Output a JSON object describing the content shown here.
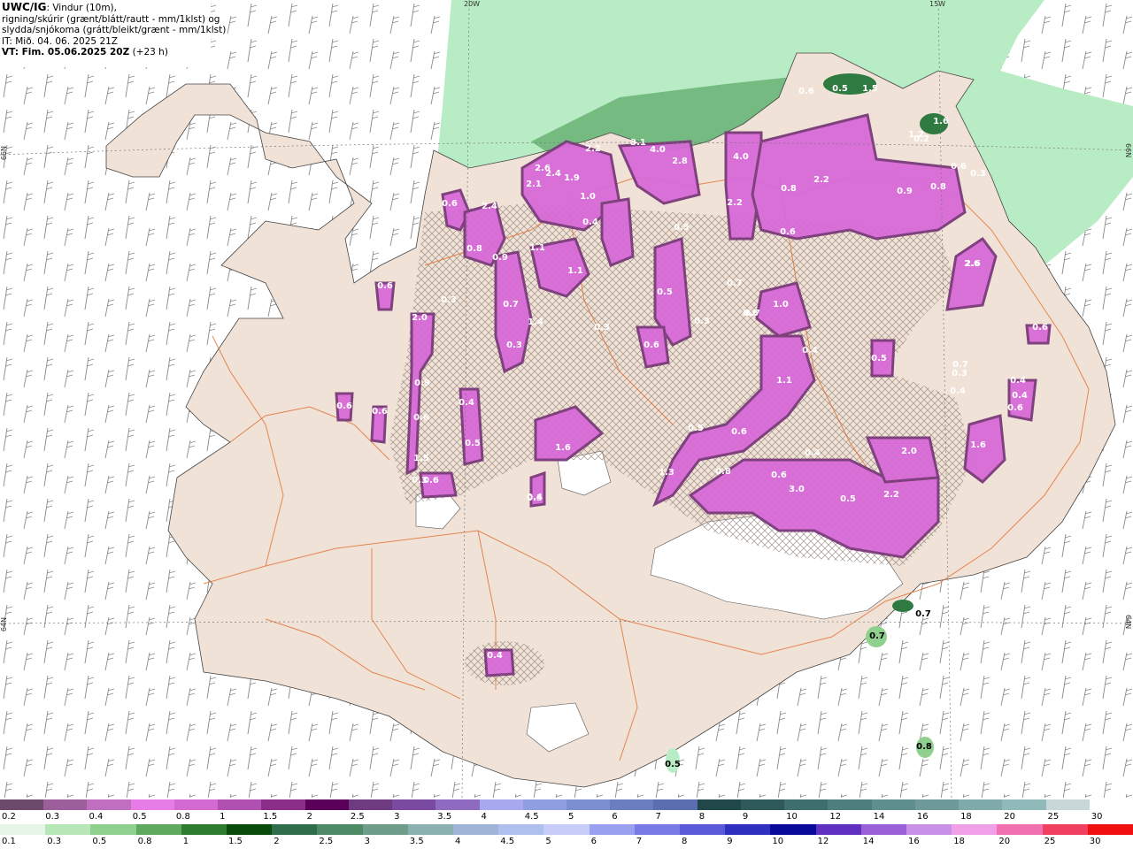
{
  "header": {
    "source": "UWC/IG",
    "title_rest": ": Vindur (10m),",
    "line2": "rigning/skúrir (grænt/blátt/rautt - mm/1klst) og",
    "line3": "slydda/snjókoma (grátt/bleikt/grænt - mm/1klst)",
    "it": "IT: Mið. 04. 06. 2025 21Z",
    "vt_bold": "VT: Fim. 05.06.2025 20Z",
    "vt_rest": " (+23 h)"
  },
  "axes": {
    "top_left": "20W",
    "top_right": "15W",
    "left_upper": "66N",
    "left_lower": "64N",
    "right_upper": "66N",
    "right_lower": "64N"
  },
  "labels": [
    "0.6",
    "0.5",
    "1.5",
    "1.6",
    "1.2",
    "0.2",
    "0.6",
    "0.3",
    "2.6",
    "2.2",
    "3.1",
    "4.0",
    "2.8",
    "4.0",
    "2.2",
    "0.8",
    "0.9",
    "0.8",
    "2.1",
    "2.6",
    "2.4",
    "1.9",
    "1.0",
    "2.2",
    "0.6",
    "2.4",
    "0.9",
    "0.8",
    "1.1",
    "1.1",
    "0.4",
    "0.5",
    "0.6",
    "0.7",
    "0.3",
    "0.3",
    "0.7",
    "1.4",
    "0.6",
    "0.5",
    "0.3",
    "0.7",
    "1.0",
    "0.6",
    "0.3",
    "2.6",
    "0.4",
    "0.3",
    "0.7",
    "2.0",
    "0.9",
    "0.6",
    "0.6",
    "0.4",
    "0.5",
    "0.6",
    "1.5",
    "0.3",
    "0.6",
    "1.6",
    "0.4",
    "0.5",
    "0.4",
    "0.5",
    "1.1",
    "0.5",
    "0.6",
    "0.4",
    "0.4",
    "0.6",
    "1.6",
    "2.0",
    "1.3",
    "0.8",
    "0.6",
    "3.0",
    "0.5",
    "2.2",
    "0.7",
    "0.7",
    "0.4",
    "0.8",
    "0.5",
    "0.6",
    "0.6",
    "0.4"
  ],
  "colorbar_snow": {
    "labels": [
      "0.2",
      "0.3",
      "0.4",
      "0.5",
      "0.8",
      "1",
      "1.5",
      "2",
      "2.5",
      "3",
      "3.5",
      "4",
      "4.5",
      "5",
      "6",
      "7",
      "8",
      "9",
      "10",
      "12",
      "14",
      "16",
      "18",
      "20",
      "25",
      "30"
    ],
    "colors": [
      "#6b4a6b",
      "#9c5f9c",
      "#c06ec0",
      "#e67ce6",
      "#d26ad2",
      "#b050b0",
      "#8a2e8a",
      "#5a005a",
      "#6e3a80",
      "#7a4aa0",
      "#8e6ac0",
      "#a8a8ee",
      "#8e9ee0",
      "#7a8ed0",
      "#6a7ec0",
      "#5a6eb0",
      "#204848",
      "#2e5a5a",
      "#3e6e6e",
      "#4e7e7e",
      "#5e8e8e",
      "#6e9a9a",
      "#7eaaaa",
      "#90baba",
      "#c8d8d8",
      "#ffffff"
    ]
  },
  "colorbar_rain": {
    "labels": [
      "0.1",
      "0.3",
      "0.5",
      "0.8",
      "1",
      "1.5",
      "2",
      "2.5",
      "3",
      "3.5",
      "4",
      "4.5",
      "5",
      "6",
      "7",
      "8",
      "9",
      "10",
      "12",
      "14",
      "16",
      "18",
      "20",
      "25",
      "30"
    ],
    "colors": [
      "#e6f5e6",
      "#b7e6b7",
      "#8fd08f",
      "#5fa95f",
      "#2e7d2e",
      "#0a4a0a",
      "#2f6e4a",
      "#4e8a66",
      "#6e9e8a",
      "#8ab0b0",
      "#a0b4d8",
      "#b0c0ee",
      "#c8ccf8",
      "#9aa0f0",
      "#7a7ae6",
      "#5a5ad8",
      "#3030c0",
      "#0a0a9a",
      "#6030c0",
      "#9a60d8",
      "#c890e6",
      "#f0a0e6",
      "#f070b0",
      "#f04060",
      "#f01010"
    ]
  },
  "colors": {
    "land": "#f0e2d6",
    "sea": "#ffffff",
    "roads": "#e2743a",
    "snow_core": "#d76ad8",
    "snow_edge": "#7a3a7a",
    "rain_light": "#b8ecc4",
    "rain_dark": "#2f7a40"
  }
}
